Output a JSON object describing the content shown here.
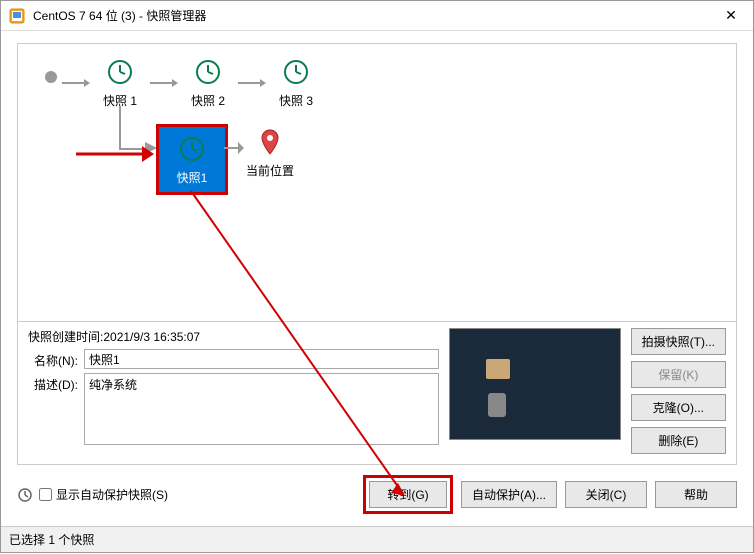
{
  "title": "CentOS 7 64 位 (3) - 快照管理器",
  "snapshots": {
    "row1": [
      {
        "label": "快照 1"
      },
      {
        "label": "快照 2"
      },
      {
        "label": "快照 3"
      }
    ],
    "selected": {
      "label": "快照1"
    },
    "current": {
      "label": "当前位置"
    }
  },
  "details": {
    "created_prefix": "快照创建时间:",
    "created_value": "2021/9/3 16:35:07",
    "name_label": "名称(N):",
    "name_value": "快照1",
    "desc_label": "描述(D):",
    "desc_value": "纯净系统"
  },
  "buttons": {
    "take": "拍摄快照(T)...",
    "keep": "保留(K)",
    "clone": "克隆(O)...",
    "delete": "删除(E)",
    "goto": "转到(G)",
    "autoprotect": "自动保护(A)...",
    "close": "关闭(C)",
    "help": "帮助"
  },
  "footer": {
    "show_autoprotect": "显示自动保护快照(S)"
  },
  "status": "已选择 1 个快照"
}
